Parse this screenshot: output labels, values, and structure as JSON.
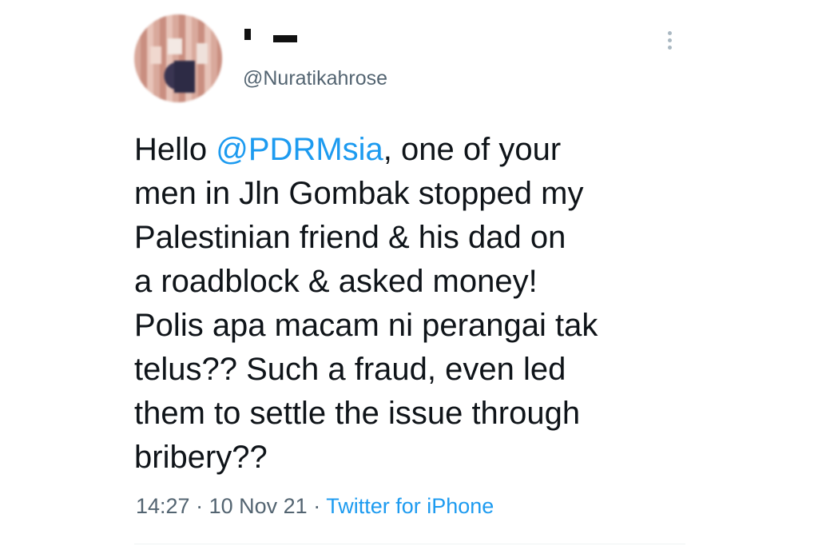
{
  "author": {
    "handle": "@Nuratikahrose"
  },
  "tweet": {
    "greeting": "Hello ",
    "mention": "@PDRMsia",
    "text": ", one of your\nmen in Jln Gombak stopped my\nPalestinian friend & his dad on\na roadblock & asked money!\nPolis apa macam ni perangai tak\ntelus?? Such a fraud, even led\nthem to settle the issue through\nbribery??",
    "time": "14:27",
    "separator": "·",
    "date": "10 Nov 21",
    "source": "Twitter for iPhone"
  },
  "icons": {
    "more": "more-vertical-icon"
  },
  "colors": {
    "link": "#1d9bf0",
    "text": "#0f1419",
    "muted": "#536471"
  }
}
